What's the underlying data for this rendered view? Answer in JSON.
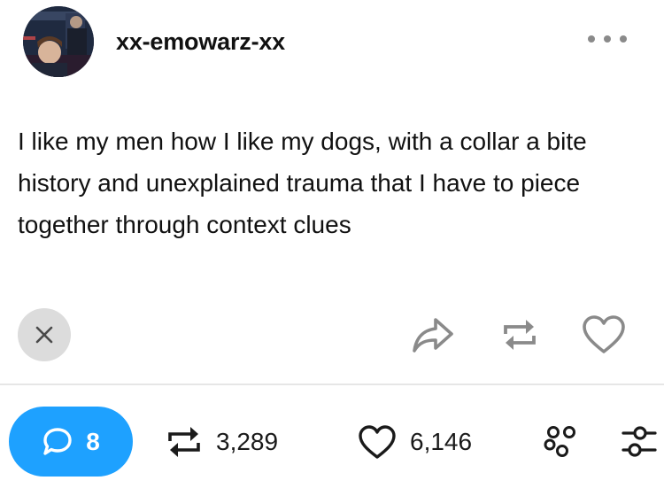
{
  "post": {
    "username": "xx-emowarz-xx",
    "text": "I like my men how I like my dogs, with a collar a bite history and unexplained trauma that I have to piece together through context clues"
  },
  "icons": {
    "avatar": "avatar-image",
    "more": "ellipsis-icon",
    "dismiss": "close-icon",
    "share": "share-arrow-icon",
    "reblog": "reblog-icon",
    "like": "heart-icon",
    "replies": "speech-bubble-icon",
    "filter": "filter-icon",
    "settings": "sliders-icon"
  },
  "stats": {
    "replies": "8",
    "reblogs": "3,289",
    "likes": "6,146"
  },
  "colors": {
    "accent": "#1ea1ff",
    "icon": "#8a8a8a",
    "text": "#111111",
    "dismiss_bg": "#dcdcdc"
  }
}
